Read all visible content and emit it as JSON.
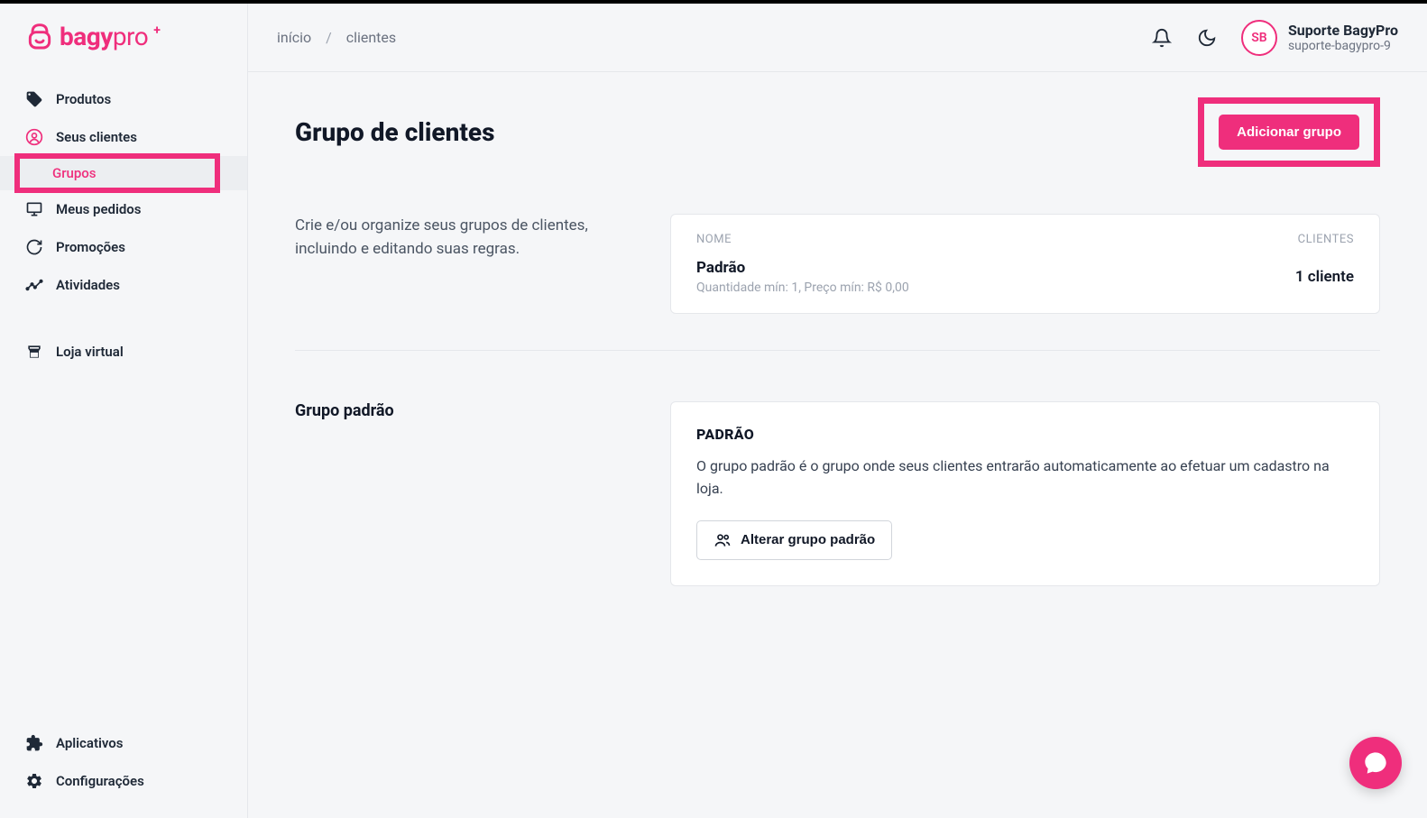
{
  "logo": {
    "text_main": "bagy",
    "text_pro": "pro"
  },
  "sidebar": {
    "items": [
      {
        "label": "Produtos"
      },
      {
        "label": "Seus clientes"
      },
      {
        "label": "Grupos"
      },
      {
        "label": "Meus pedidos"
      },
      {
        "label": "Promoções"
      },
      {
        "label": "Atividades"
      },
      {
        "label": "Loja virtual"
      }
    ],
    "bottom": [
      {
        "label": "Aplicativos"
      },
      {
        "label": "Configurações"
      }
    ]
  },
  "breadcrumb": {
    "home": "início",
    "current": "clientes"
  },
  "user": {
    "initials": "SB",
    "name": "Suporte BagyPro",
    "subtitle": "suporte-bagypro-9"
  },
  "page": {
    "title": "Grupo de clientes",
    "add_button": "Adicionar grupo"
  },
  "section1": {
    "description": "Crie e/ou organize seus grupos de clientes, incluindo e editando suas regras.",
    "table": {
      "col_name": "NOME",
      "col_clients": "CLIENTES",
      "rows": [
        {
          "name": "Padrão",
          "subtitle": "Quantidade mín: 1, Preço mín: R$ 0,00",
          "clients": "1 cliente"
        }
      ]
    }
  },
  "section2": {
    "heading": "Grupo padrão",
    "card_title": "PADRÃO",
    "card_desc": "O grupo padrão é o grupo onde seus clientes entrarão automaticamente ao efetuar um cadastro na loja.",
    "change_button": "Alterar grupo padrão"
  }
}
